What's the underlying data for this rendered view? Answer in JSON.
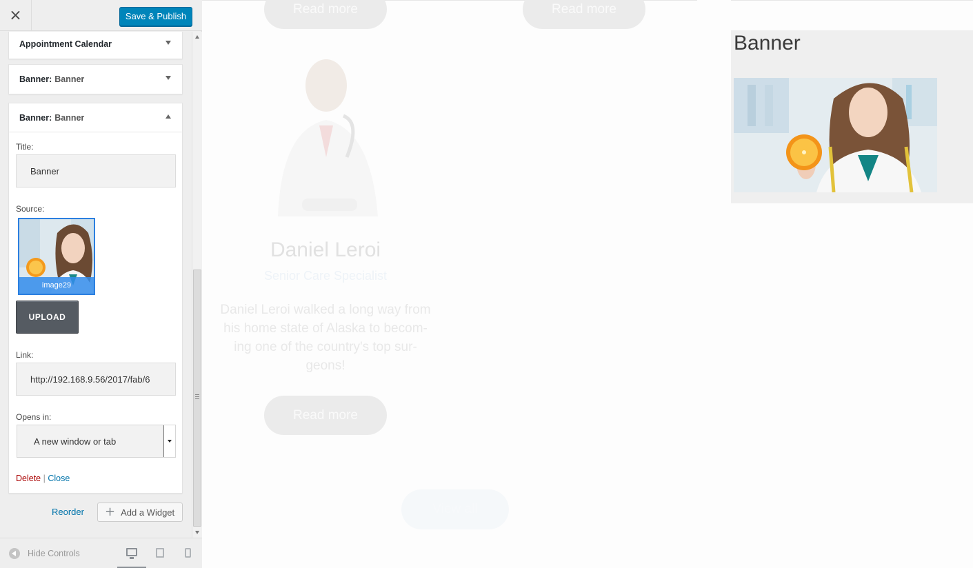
{
  "toolbar": {
    "close_icon": "×",
    "publish_label": "Save & Publish"
  },
  "sections": {
    "appointment": {
      "label": "Appointment Calendar"
    },
    "banner1": {
      "prefix": "Banner:",
      "name": "Banner"
    },
    "banner2": {
      "prefix": "Banner:",
      "name": "Banner"
    }
  },
  "widget_form": {
    "title_label": "Title:",
    "title_value": "Banner",
    "source_label": "Source:",
    "image_caption": "image29",
    "upload_label": "UPLOAD",
    "link_label": "Link:",
    "link_value": "http://192.168.9.56/2017/fab/6",
    "opens_label": "Opens in:",
    "opens_value": "A new window or tab",
    "delete_label": "Delete",
    "separator": "|",
    "close_label": "Close"
  },
  "panel_actions": {
    "reorder_label": "Reorder",
    "add_widget_label": "Add a Widget"
  },
  "footer": {
    "hide_controls_label": "Hide Controls",
    "icons": [
      "desktop-icon",
      "tablet-icon",
      "mobile-icon"
    ]
  },
  "preview": {
    "read_more_1": "Read more",
    "read_more_2": "Read more",
    "read_more_3": "Read more",
    "doctor_name": "Daniel Leroi",
    "doctor_role": "Senior Care Specialist",
    "doctor_bio": "Daniel Leroi walked a long way from his home state of Alaska to becom-ing one of the country's top sur-geons!",
    "view_all": "View all",
    "banner_title": "Banner"
  },
  "colors": {
    "accent": "#0085ba",
    "delete": "#aa0000",
    "link": "#0073aa",
    "upload_bg": "#555b62"
  }
}
